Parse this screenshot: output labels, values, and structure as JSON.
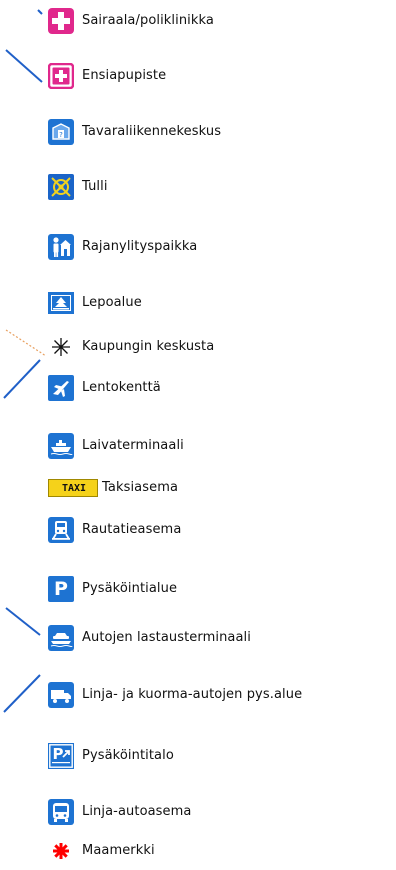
{
  "colors": {
    "hospital": "#e0288c",
    "firstaid": "#e0288c",
    "service_blue": "#1e73d2",
    "customs_blue": "#1a64c8",
    "customs_yellow": "#f2d21e",
    "taxi_yellow": "#f5d21a",
    "landmark_red": "#ff0000",
    "map_line": "#2060c8",
    "map_dotted": "#e8a060"
  },
  "legend": {
    "items": [
      {
        "icon": "hospital-icon",
        "label": "Sairaala/poliklinikka"
      },
      {
        "icon": "first-aid-icon",
        "label": "Ensiapupiste"
      },
      {
        "icon": "freight-center-icon",
        "label": "Tavaraliikennekeskus"
      },
      {
        "icon": "customs-icon",
        "label": "Tulli"
      },
      {
        "icon": "border-crossing-icon",
        "label": "Rajanylityspaikka"
      },
      {
        "icon": "rest-area-icon",
        "label": "Lepoalue"
      },
      {
        "icon": "city-center-icon",
        "label": "Kaupungin keskusta"
      },
      {
        "icon": "airport-icon",
        "label": "Lentokenttä"
      },
      {
        "icon": "ship-terminal-icon",
        "label": "Laivaterminaali"
      },
      {
        "icon": "taxi-icon",
        "label": "Taksiasema",
        "icon_text": "TAXI"
      },
      {
        "icon": "railway-station-icon",
        "label": "Rautatieasema"
      },
      {
        "icon": "parking-icon",
        "label": "Pysäköintialue",
        "icon_text": "P"
      },
      {
        "icon": "car-ferry-terminal-icon",
        "label": "Autojen lastausterminaali"
      },
      {
        "icon": "truck-parking-icon",
        "label": "Linja- ja kuorma-autojen pys.alue"
      },
      {
        "icon": "parking-garage-icon",
        "label": "Pysäköintitalo",
        "icon_text": "P"
      },
      {
        "icon": "bus-station-icon",
        "label": "Linja-autoasema"
      },
      {
        "icon": "landmark-icon",
        "label": "Maamerkki"
      }
    ]
  }
}
